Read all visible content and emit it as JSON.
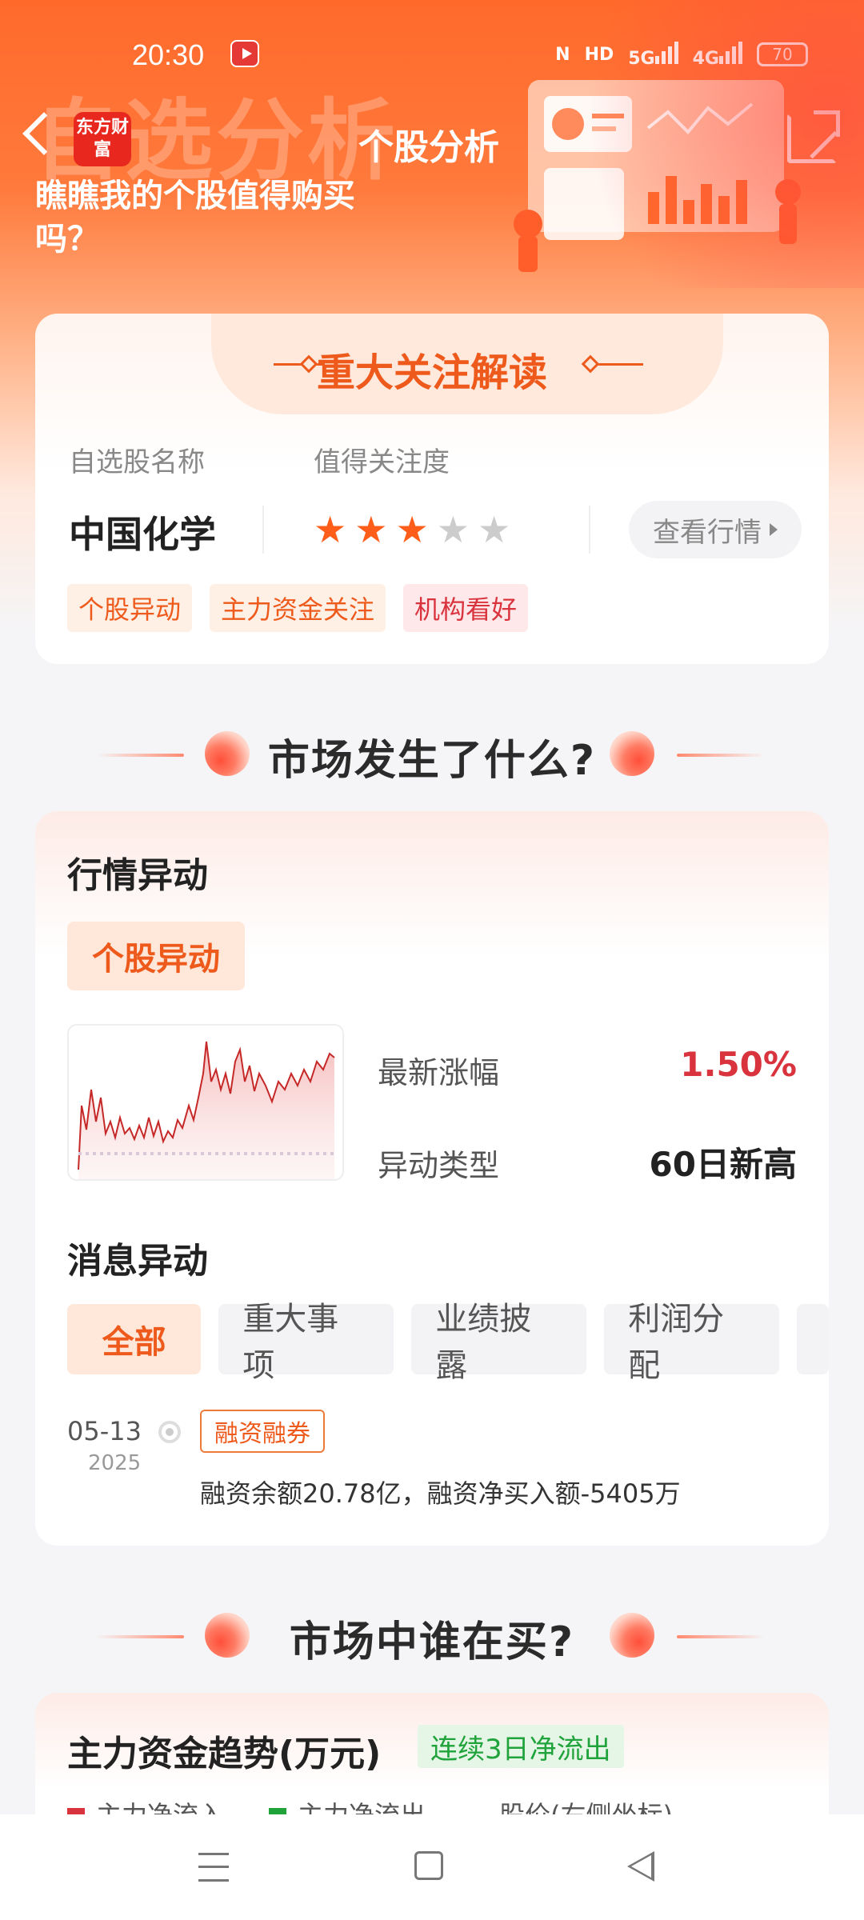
{
  "status_bar": {
    "time": "20:30",
    "nfc": "N",
    "hd": "HD",
    "net1": "5G",
    "net2": "4G",
    "battery": "70"
  },
  "header": {
    "logo_text": "东方财富",
    "watermark": "自选分析",
    "title": "个股分析",
    "slogan": "瞧瞧我的个股值得购买吗？"
  },
  "focus_card": {
    "title": "重大关注解读",
    "stock_name_label": "自选股名称",
    "attention_label": "值得关注度",
    "stock_name": "中国化学",
    "rating": 3,
    "rating_max": 5,
    "view_button": "查看行情",
    "tags": [
      "个股异动",
      "主力资金关注",
      "机构看好"
    ]
  },
  "section1_title": "市场发生了什么?",
  "market_card": {
    "quote_title": "行情异动",
    "pill": "个股异动",
    "latest_change_label": "最新涨幅",
    "latest_change_value": "1.50%",
    "anomaly_type_label": "异动类型",
    "anomaly_type_value": "60日新高",
    "news_title": "消息异动",
    "filters": [
      "全部",
      "重大事项",
      "业绩披露",
      "利润分配"
    ],
    "news": {
      "date": "05-13",
      "year": "2025",
      "tag": "融资融券",
      "text": "融资余额20.78亿，融资净买入额-5405万"
    }
  },
  "section2_title": "市场中谁在买?",
  "fund_card": {
    "title": "主力资金趋势(万元)",
    "badge": "连续3日净流出",
    "legend": [
      "主力净流入",
      "主力净流出",
      "股价(右侧坐标)"
    ]
  },
  "colors": {
    "accent": "#ee5a1c",
    "up": "#d9343e",
    "down": "#1fa33a",
    "price": "#f0a040"
  }
}
